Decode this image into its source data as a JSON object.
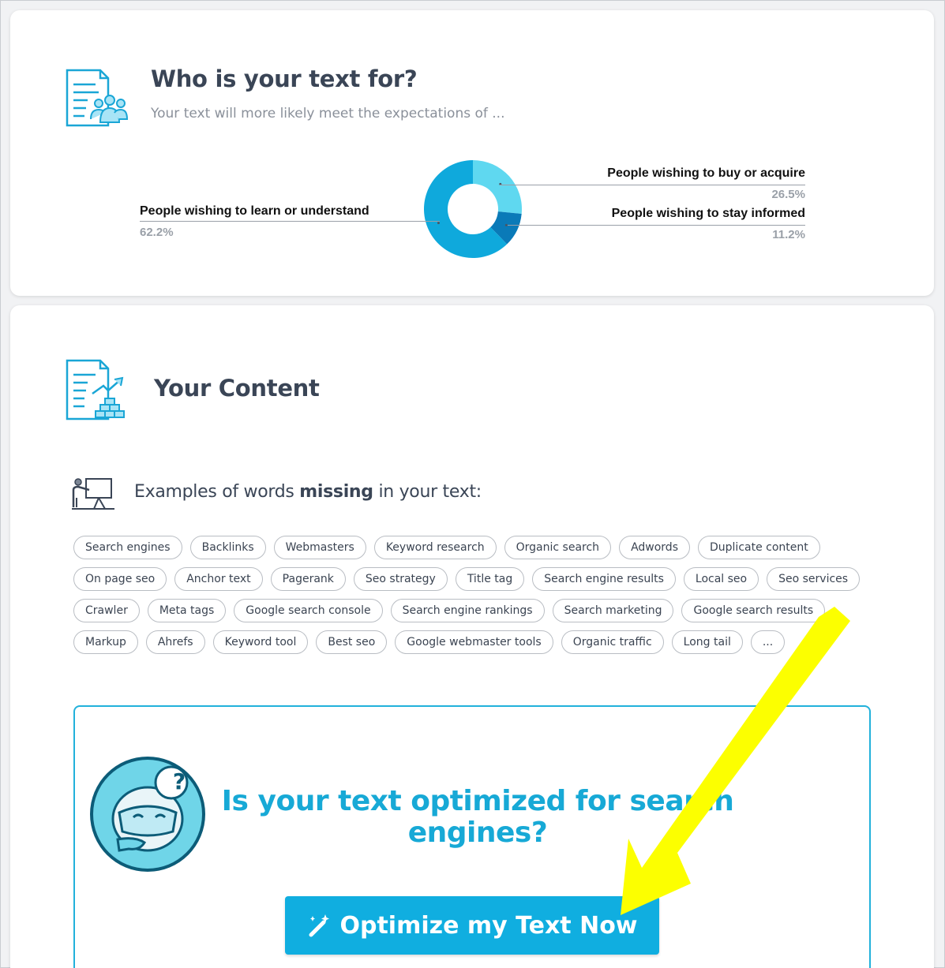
{
  "audience": {
    "title": "Who is your text for?",
    "subtitle": "Your text will more likely meet the expectations of ...",
    "icon": "document-audience-icon",
    "chart_data": {
      "type": "pie",
      "donut": true,
      "slices": [
        {
          "label": "People wishing to buy or acquire",
          "value": 26.5,
          "display": "26.5%",
          "color": "#5fd8f0"
        },
        {
          "label": "People wishing to stay informed",
          "value": 11.2,
          "display": "11.2%",
          "color": "#0a7ab8"
        },
        {
          "label": "People wishing to learn or understand",
          "value": 62.2,
          "display": "62.2%",
          "color": "#0fa9dc"
        }
      ],
      "legend": "labels with leader lines"
    }
  },
  "content": {
    "title": "Your Content",
    "icon": "document-building-icon",
    "missing_words": {
      "title_prefix": "Examples of words ",
      "title_bold": "missing",
      "title_suffix": " in your text:",
      "icon": "presentation-teacher-icon",
      "rows": [
        [
          "Search engines",
          "Backlinks",
          "Webmasters",
          "Keyword research",
          "Organic search",
          "Adwords",
          "Duplicate content"
        ],
        [
          "On page seo",
          "Anchor text",
          "Pagerank",
          "Seo strategy",
          "Title tag",
          "Search engine results",
          "Local seo",
          "Seo services"
        ],
        [
          "Crawler",
          "Meta tags",
          "Google search console",
          "Search engine rankings",
          "Search marketing",
          "Google search results"
        ],
        [
          "Markup",
          "Ahrefs",
          "Keyword tool",
          "Best seo",
          "Google webmaster tools",
          "Organic traffic",
          "Long tail",
          "..."
        ]
      ]
    },
    "cta": {
      "title": "Is your text optimized for search engines?",
      "button_label": "Optimize my Text Now",
      "button_icon": "magic-wand-icon",
      "mascot_icon": "thinking-robot-icon",
      "mascot_symbol": "?"
    }
  },
  "annotation": {
    "arrow_color": "#fcff00"
  }
}
